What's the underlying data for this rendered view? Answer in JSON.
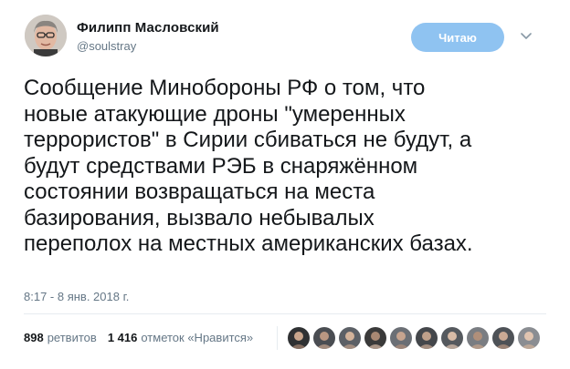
{
  "author": {
    "name": "Филипп Масловский",
    "handle": "@soulstray"
  },
  "follow_button": {
    "label": "Читаю"
  },
  "tweet": {
    "lines": [
      "Сообщение Минобороны РФ о том, что",
      "новые атакующие дроны \"умеренных",
      "террористов\" в Сирии сбиваться не будут, а",
      "будут средствами РЭБ в снаряжённом",
      "состоянии возвращаться на места",
      "базирования, вызвало небывалых",
      "переполох на местных американских базах."
    ],
    "timestamp": "8:17 - 8 янв. 2018 г."
  },
  "stats": {
    "retweets_count": "898",
    "retweets_label": "ретвитов",
    "likes_count": "1 416",
    "likes_label": "отметок «Нравится»"
  },
  "likers": {
    "count": 10,
    "icon_names": [
      "avatar-icon"
    ]
  },
  "colors": {
    "text": "#14171a",
    "secondary": "#657786",
    "follow_button": "#8fc3f1",
    "divider": "#e6ecf0"
  }
}
